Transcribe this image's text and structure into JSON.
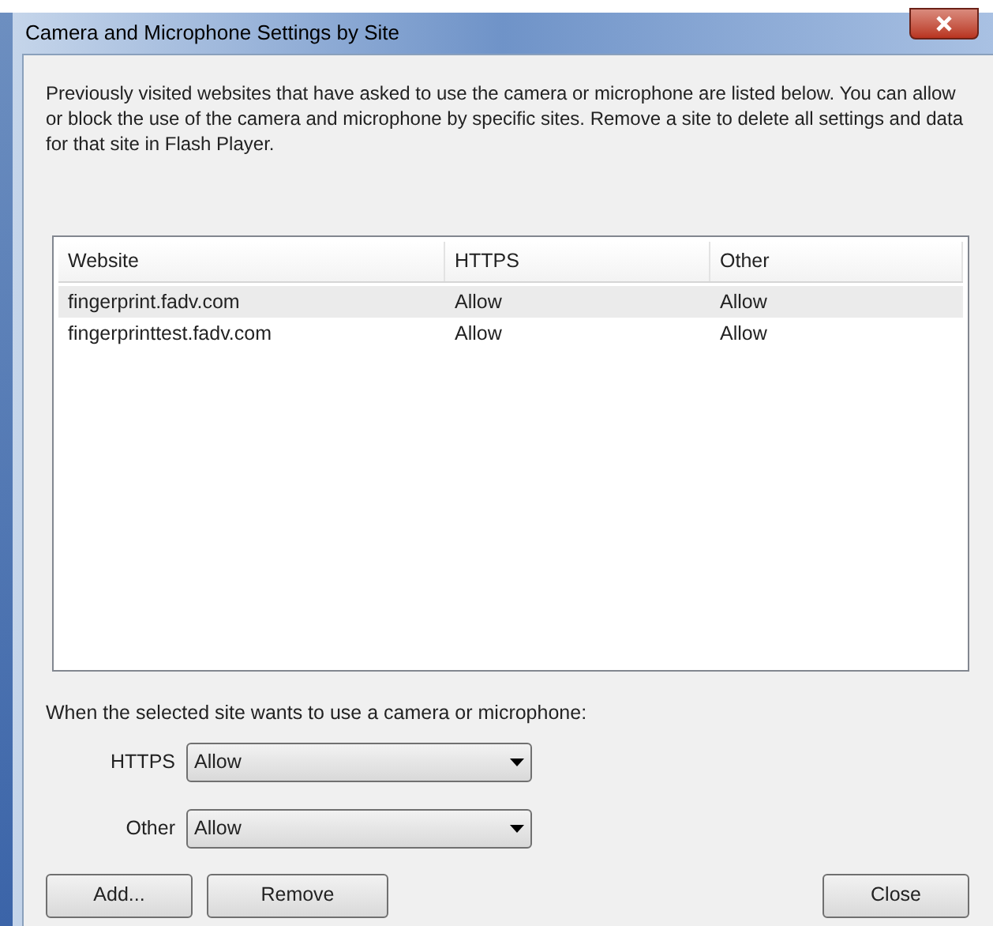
{
  "window": {
    "title": "Camera and Microphone Settings by Site"
  },
  "description": "Previously visited websites that have asked to use the camera or microphone are listed below. You can allow or block the use of the camera and microphone by specific sites. Remove a site to delete all settings and data for that site in Flash Player.",
  "table": {
    "columns": [
      "Website",
      "HTTPS",
      "Other"
    ],
    "rows": [
      {
        "cells": [
          "fingerprint.fadv.com",
          "Allow",
          "Allow"
        ],
        "selected": true
      },
      {
        "cells": [
          "fingerprinttest.fadv.com",
          "Allow",
          "Allow"
        ],
        "selected": false
      }
    ]
  },
  "prompt": "When the selected site wants to use a camera or microphone:",
  "dropdowns": [
    {
      "label": "HTTPS",
      "value": "Allow"
    },
    {
      "label": "Other",
      "value": "Allow"
    }
  ],
  "left_buttons": [
    "Add...",
    "Remove"
  ],
  "right_buttons": [
    "Close"
  ]
}
